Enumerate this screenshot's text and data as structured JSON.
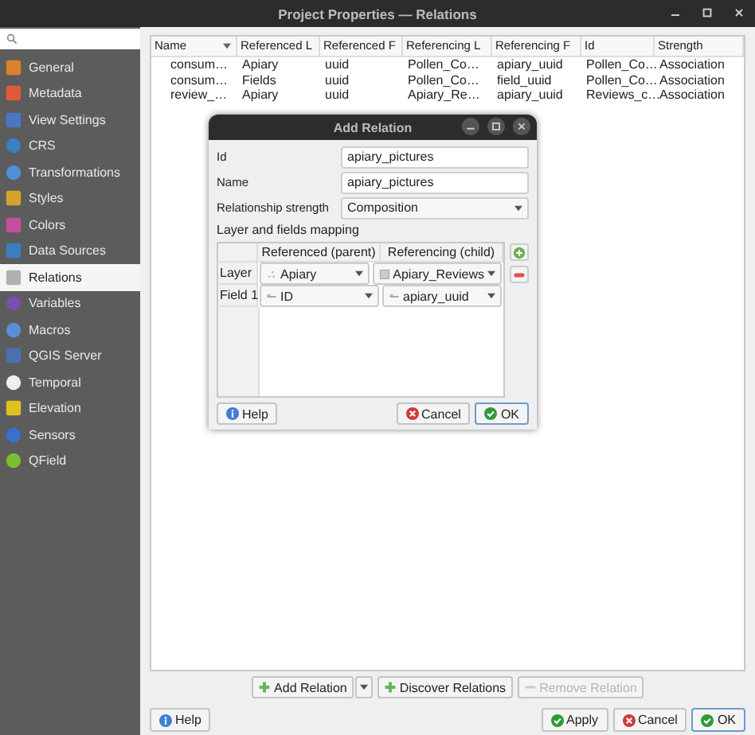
{
  "window": {
    "title": "Project Properties — Relations"
  },
  "sidebar": {
    "items": [
      {
        "label": "General",
        "selected": false
      },
      {
        "label": "Metadata",
        "selected": false
      },
      {
        "label": "View Settings",
        "selected": false
      },
      {
        "label": "CRS",
        "selected": false
      },
      {
        "label": "Transformations",
        "selected": false
      },
      {
        "label": "Styles",
        "selected": false
      },
      {
        "label": "Colors",
        "selected": false
      },
      {
        "label": "Data Sources",
        "selected": false
      },
      {
        "label": "Relations",
        "selected": true
      },
      {
        "label": "Variables",
        "selected": false
      },
      {
        "label": "Macros",
        "selected": false
      },
      {
        "label": "QGIS Server",
        "selected": false
      },
      {
        "label": "Temporal",
        "selected": false
      },
      {
        "label": "Elevation",
        "selected": false
      },
      {
        "label": "Sensors",
        "selected": false
      },
      {
        "label": "QField",
        "selected": false
      }
    ]
  },
  "relations_table": {
    "columns": [
      "Name",
      "Referenced L",
      "Referenced F",
      "Referencing L",
      "Referencing F",
      "Id",
      "Strength"
    ],
    "rows": [
      [
        "consum…",
        "Apiary",
        "uuid",
        "Pollen_Co…",
        "apiary_uuid",
        "Pollen_Co…",
        "Association"
      ],
      [
        "consum…",
        "Fields",
        "uuid",
        "Pollen_Co…",
        "field_uuid",
        "Pollen_Co…",
        "Association"
      ],
      [
        "review_…",
        "Apiary",
        "uuid",
        "Apiary_Re…",
        "apiary_uuid",
        "Reviews_c…",
        "Association"
      ]
    ]
  },
  "relation_buttons": [
    {
      "label": "Add Relation",
      "kind": "add",
      "has_menu": true,
      "disabled": false
    },
    {
      "label": "Discover Relations",
      "kind": "add",
      "has_menu": false,
      "disabled": false
    },
    {
      "label": "Remove Relation",
      "kind": "remove",
      "has_menu": false,
      "disabled": true
    }
  ],
  "footer_buttons": [
    {
      "label": "Help",
      "kind": "help",
      "default": false
    },
    {
      "label": "Apply",
      "kind": "ok",
      "default": false
    },
    {
      "label": "Cancel",
      "kind": "cancel",
      "default": false
    },
    {
      "label": "OK",
      "kind": "ok",
      "default": true
    }
  ],
  "add_relation_dialog": {
    "title": "Add Relation",
    "fields": [
      {
        "label": "Id",
        "value": "apiary_pictures",
        "kind": "text"
      },
      {
        "label": "Name",
        "value": "apiary_pictures",
        "kind": "text"
      },
      {
        "label": "Relationship strength",
        "value": "Composition",
        "kind": "combo"
      }
    ],
    "mapping_label": "Layer and fields mapping",
    "mapping": {
      "columns": [
        "Referenced (parent)",
        "Referencing (child)"
      ],
      "rows": [
        {
          "label": "Layer",
          "parent": "Apiary",
          "child": "Apiary_Reviews",
          "kind": "layer"
        },
        {
          "label": "Field 1",
          "parent": "ID",
          "child": "apiary_uuid",
          "kind": "field"
        }
      ]
    },
    "buttons": [
      {
        "label": "Help",
        "kind": "help",
        "default": false
      },
      {
        "label": "Cancel",
        "kind": "cancel",
        "default": false
      },
      {
        "label": "OK",
        "kind": "ok",
        "default": true
      }
    ]
  }
}
